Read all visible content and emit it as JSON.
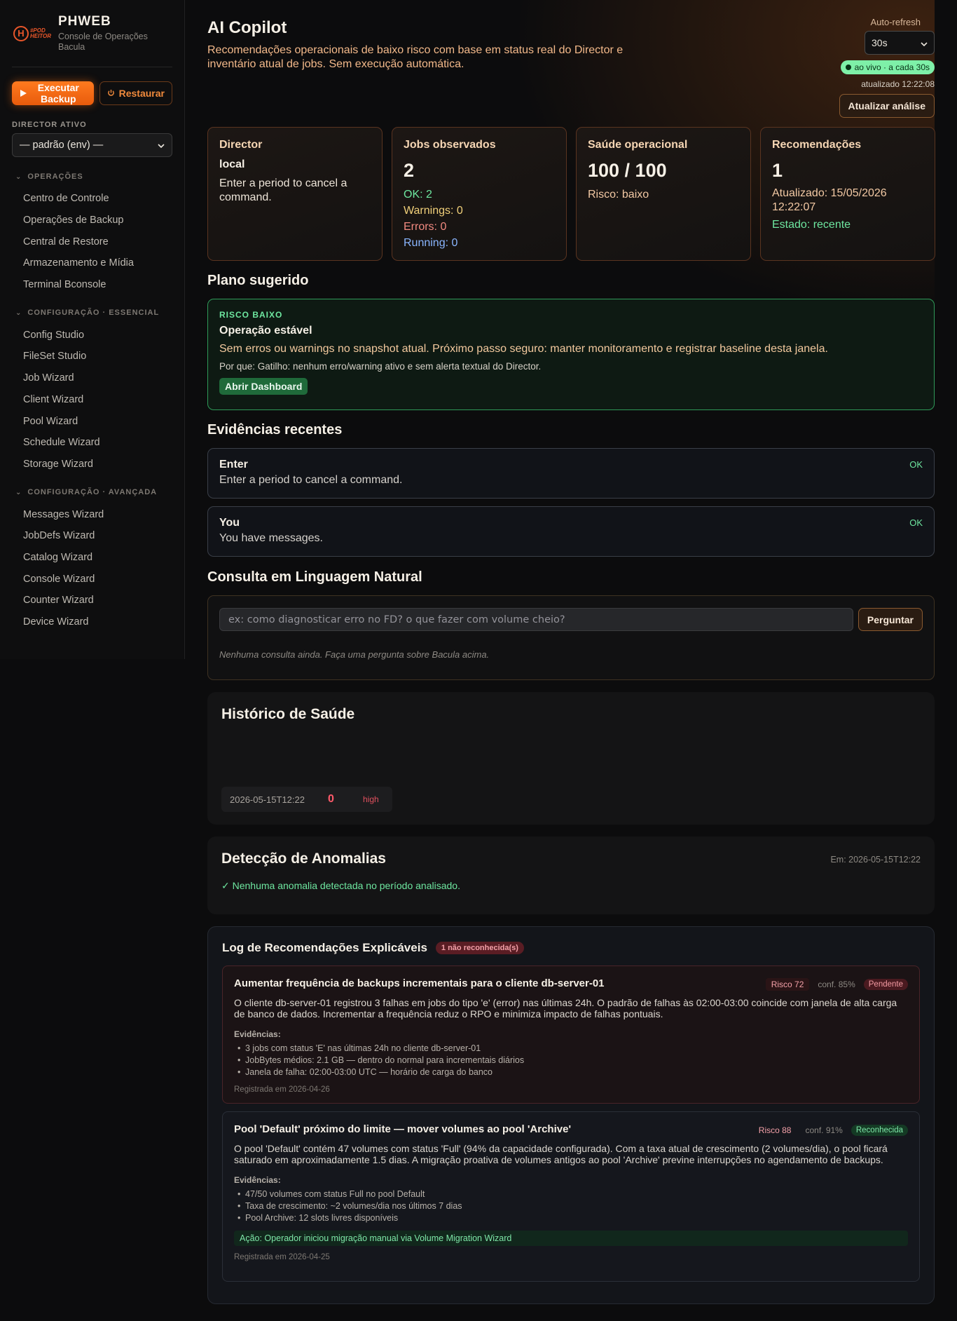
{
  "sidebar": {
    "brand_title": "PHWEB",
    "brand_subtitle": "Console de Operações Bacula",
    "logo_text": "#POD HEITOR",
    "run_backup": "Executar Backup",
    "restore": "Restaurar",
    "director_label": "DIRECTOR ATIVO",
    "director_value": "— padrão (env) —",
    "sections": [
      {
        "title": "OPERAÇÕES",
        "items": [
          "Centro de Controle",
          "Operações de Backup",
          "Central de Restore",
          "Armazenamento e Mídia",
          "Terminal Bconsole"
        ]
      },
      {
        "title": "CONFIGURAÇÃO · ESSENCIAL",
        "items": [
          "Config Studio",
          "FileSet Studio",
          "Job Wizard",
          "Client Wizard",
          "Pool Wizard",
          "Schedule Wizard",
          "Storage Wizard"
        ]
      },
      {
        "title": "CONFIGURAÇÃO · AVANÇADA",
        "items": [
          "Messages Wizard",
          "JobDefs Wizard",
          "Catalog Wizard",
          "Console Wizard",
          "Counter Wizard",
          "Device Wizard"
        ]
      }
    ]
  },
  "header": {
    "title": "AI Copilot",
    "subtitle": "Recomendações operacionais de baixo risco com base em status real do Director e inventário atual de jobs. Sem execução automática.",
    "auto_refresh_label": "Auto-refresh",
    "auto_refresh_value": "30s",
    "live_status": "ao vivo · a cada 30s",
    "updated": "atualizado 12:22:08",
    "refresh_button": "Atualizar análise"
  },
  "kpis": {
    "director": {
      "title": "Director",
      "name": "local",
      "text": "Enter a period to cancel a command."
    },
    "jobs": {
      "title": "Jobs observados",
      "count": "2",
      "ok": "OK: 2",
      "warnings": "Warnings: 0",
      "errors": "Errors: 0",
      "running": "Running: 0"
    },
    "health": {
      "title": "Saúde operacional",
      "score": "100 / 100",
      "risk": "Risco: baixo"
    },
    "recs": {
      "title": "Recomendações",
      "count": "1",
      "updated": "Atualizado: 15/05/2026 12:22:07",
      "state": "Estado: recente"
    }
  },
  "plan": {
    "section_title": "Plano sugerido",
    "risk": "RISCO BAIXO",
    "heading": "Operação estável",
    "text": "Sem erros ou warnings no snapshot atual. Próximo passo seguro: manter monitoramento e registrar baseline desta janela.",
    "why": "Por que: Gatilho: nenhum erro/warning ativo e sem alerta textual do Director.",
    "button": "Abrir Dashboard"
  },
  "evidence": {
    "section_title": "Evidências recentes",
    "items": [
      {
        "title": "Enter",
        "text": "Enter a period to cancel a command.",
        "status": "OK"
      },
      {
        "title": "You",
        "text": "You have messages.",
        "status": "OK"
      }
    ]
  },
  "query": {
    "section_title": "Consulta em Linguagem Natural",
    "placeholder": "ex: como diagnosticar erro no FD? o que fazer com volume cheio?",
    "button": "Perguntar",
    "empty": "Nenhuma consulta ainda. Faça uma pergunta sobre Bacula acima."
  },
  "health_history": {
    "title": "Histórico de Saúde",
    "entries": [
      {
        "date": "2026-05-15T12:22",
        "value": "0",
        "level": "high"
      }
    ]
  },
  "anomalies": {
    "title": "Detecção de Anomalias",
    "date": "Em: 2026-05-15T12:22",
    "message": "✓ Nenhuma anomalia detectada no período analisado."
  },
  "log": {
    "title": "Log de Recomendações Explicáveis",
    "badge": "1 não reconhecida(s)",
    "evidence_label": "Evidências:",
    "recommendations": [
      {
        "title": "Aumentar frequência de backups incrementais para o cliente db-server-01",
        "risk": "Risco 72",
        "confidence": "conf. 85%",
        "status": "Pendente",
        "description": "O cliente db-server-01 registrou 3 falhas em jobs do tipo 'e' (error) nas últimas 24h. O padrão de falhas às 02:00-03:00 coincide com janela de alta carga de banco de dados. Incrementar a frequência reduz o RPO e minimiza impacto de falhas pontuais.",
        "evidence": [
          "3 jobs com status 'E' nas últimas 24h no cliente db-server-01",
          "JobBytes médios: 2.1 GB — dentro do normal para incrementais diários",
          "Janela de falha: 02:00-03:00 UTC — horário de carga do banco"
        ],
        "registered": "Registrada em 2026-04-26"
      },
      {
        "title": "Pool 'Default' próximo do limite — mover volumes ao pool 'Archive'",
        "risk": "Risco 88",
        "confidence": "conf. 91%",
        "status": "Reconhecida",
        "description": "O pool 'Default' contém 47 volumes com status 'Full' (94% da capacidade configurada). Com a taxa atual de crescimento (2 volumes/dia), o pool ficará saturado em aproximadamente 1.5 dias. A migração proativa de volumes antigos ao pool 'Archive' previne interrupções no agendamento de backups.",
        "evidence": [
          "47/50 volumes com status Full no pool Default",
          "Taxa de crescimento: ~2 volumes/dia nos últimos 7 dias",
          "Pool Archive: 12 slots livres disponíveis"
        ],
        "action": "Ação: Operador iniciou migração manual via Volume Migration Wizard",
        "registered": "Registrada em 2026-04-25"
      }
    ]
  }
}
